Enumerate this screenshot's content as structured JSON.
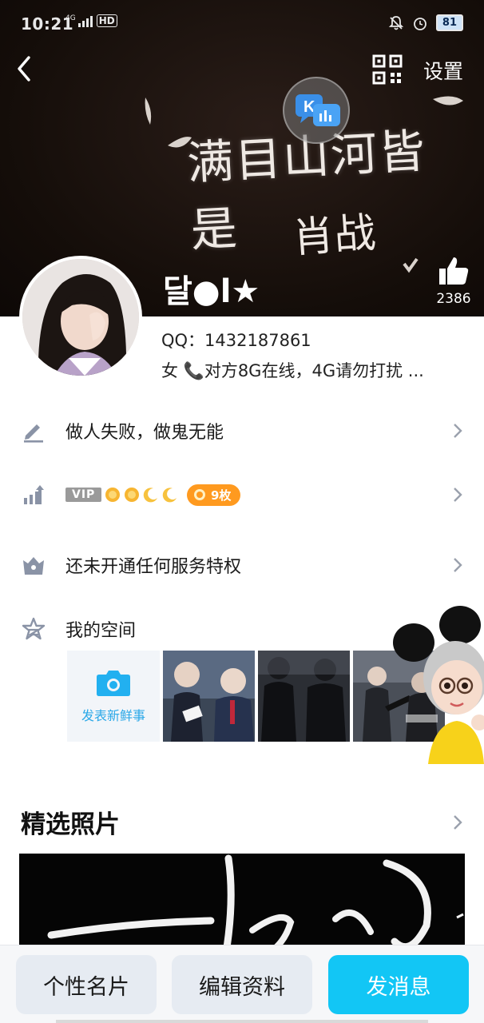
{
  "status_bar": {
    "time": "10:21",
    "network": "4G",
    "hd": "HD",
    "battery": "81"
  },
  "header": {
    "settings_label": "设置",
    "cover_line1": "满目山河皆是",
    "cover_line2": "肖战"
  },
  "profile": {
    "nickname": "달●l★",
    "like_count": "2386",
    "qq": "QQ：1432187861",
    "bio": "女  📞对方8G在线，4G请勿打扰 ..."
  },
  "rows": {
    "signature": "做人失败，做鬼无能",
    "vip_tag": "VIP",
    "coin_badge": "9枚",
    "privilege": "还未开通任何服务特权",
    "space": "我的空间"
  },
  "space": {
    "post_new_label": "发表新鲜事"
  },
  "featured": {
    "title": "精选照片"
  },
  "bottom_bar": {
    "card_label": "个性名片",
    "edit_label": "编辑资料",
    "message_label": "发消息"
  },
  "colors": {
    "accent": "#12c6f5",
    "coin": "#ff9a1f",
    "link": "#2ba8e8"
  }
}
